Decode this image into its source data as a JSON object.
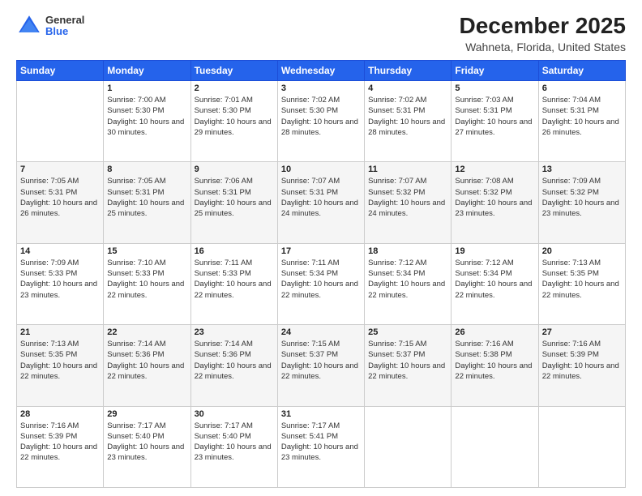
{
  "logo": {
    "general": "General",
    "blue": "Blue"
  },
  "title": "December 2025",
  "location": "Wahneta, Florida, United States",
  "days_of_week": [
    "Sunday",
    "Monday",
    "Tuesday",
    "Wednesday",
    "Thursday",
    "Friday",
    "Saturday"
  ],
  "weeks": [
    [
      {
        "day": "",
        "sunrise": "",
        "sunset": "",
        "daylight": ""
      },
      {
        "day": "1",
        "sunrise": "Sunrise: 7:00 AM",
        "sunset": "Sunset: 5:30 PM",
        "daylight": "Daylight: 10 hours and 30 minutes."
      },
      {
        "day": "2",
        "sunrise": "Sunrise: 7:01 AM",
        "sunset": "Sunset: 5:30 PM",
        "daylight": "Daylight: 10 hours and 29 minutes."
      },
      {
        "day": "3",
        "sunrise": "Sunrise: 7:02 AM",
        "sunset": "Sunset: 5:30 PM",
        "daylight": "Daylight: 10 hours and 28 minutes."
      },
      {
        "day": "4",
        "sunrise": "Sunrise: 7:02 AM",
        "sunset": "Sunset: 5:31 PM",
        "daylight": "Daylight: 10 hours and 28 minutes."
      },
      {
        "day": "5",
        "sunrise": "Sunrise: 7:03 AM",
        "sunset": "Sunset: 5:31 PM",
        "daylight": "Daylight: 10 hours and 27 minutes."
      },
      {
        "day": "6",
        "sunrise": "Sunrise: 7:04 AM",
        "sunset": "Sunset: 5:31 PM",
        "daylight": "Daylight: 10 hours and 26 minutes."
      }
    ],
    [
      {
        "day": "7",
        "sunrise": "Sunrise: 7:05 AM",
        "sunset": "Sunset: 5:31 PM",
        "daylight": "Daylight: 10 hours and 26 minutes."
      },
      {
        "day": "8",
        "sunrise": "Sunrise: 7:05 AM",
        "sunset": "Sunset: 5:31 PM",
        "daylight": "Daylight: 10 hours and 25 minutes."
      },
      {
        "day": "9",
        "sunrise": "Sunrise: 7:06 AM",
        "sunset": "Sunset: 5:31 PM",
        "daylight": "Daylight: 10 hours and 25 minutes."
      },
      {
        "day": "10",
        "sunrise": "Sunrise: 7:07 AM",
        "sunset": "Sunset: 5:31 PM",
        "daylight": "Daylight: 10 hours and 24 minutes."
      },
      {
        "day": "11",
        "sunrise": "Sunrise: 7:07 AM",
        "sunset": "Sunset: 5:32 PM",
        "daylight": "Daylight: 10 hours and 24 minutes."
      },
      {
        "day": "12",
        "sunrise": "Sunrise: 7:08 AM",
        "sunset": "Sunset: 5:32 PM",
        "daylight": "Daylight: 10 hours and 23 minutes."
      },
      {
        "day": "13",
        "sunrise": "Sunrise: 7:09 AM",
        "sunset": "Sunset: 5:32 PM",
        "daylight": "Daylight: 10 hours and 23 minutes."
      }
    ],
    [
      {
        "day": "14",
        "sunrise": "Sunrise: 7:09 AM",
        "sunset": "Sunset: 5:33 PM",
        "daylight": "Daylight: 10 hours and 23 minutes."
      },
      {
        "day": "15",
        "sunrise": "Sunrise: 7:10 AM",
        "sunset": "Sunset: 5:33 PM",
        "daylight": "Daylight: 10 hours and 22 minutes."
      },
      {
        "day": "16",
        "sunrise": "Sunrise: 7:11 AM",
        "sunset": "Sunset: 5:33 PM",
        "daylight": "Daylight: 10 hours and 22 minutes."
      },
      {
        "day": "17",
        "sunrise": "Sunrise: 7:11 AM",
        "sunset": "Sunset: 5:34 PM",
        "daylight": "Daylight: 10 hours and 22 minutes."
      },
      {
        "day": "18",
        "sunrise": "Sunrise: 7:12 AM",
        "sunset": "Sunset: 5:34 PM",
        "daylight": "Daylight: 10 hours and 22 minutes."
      },
      {
        "day": "19",
        "sunrise": "Sunrise: 7:12 AM",
        "sunset": "Sunset: 5:34 PM",
        "daylight": "Daylight: 10 hours and 22 minutes."
      },
      {
        "day": "20",
        "sunrise": "Sunrise: 7:13 AM",
        "sunset": "Sunset: 5:35 PM",
        "daylight": "Daylight: 10 hours and 22 minutes."
      }
    ],
    [
      {
        "day": "21",
        "sunrise": "Sunrise: 7:13 AM",
        "sunset": "Sunset: 5:35 PM",
        "daylight": "Daylight: 10 hours and 22 minutes."
      },
      {
        "day": "22",
        "sunrise": "Sunrise: 7:14 AM",
        "sunset": "Sunset: 5:36 PM",
        "daylight": "Daylight: 10 hours and 22 minutes."
      },
      {
        "day": "23",
        "sunrise": "Sunrise: 7:14 AM",
        "sunset": "Sunset: 5:36 PM",
        "daylight": "Daylight: 10 hours and 22 minutes."
      },
      {
        "day": "24",
        "sunrise": "Sunrise: 7:15 AM",
        "sunset": "Sunset: 5:37 PM",
        "daylight": "Daylight: 10 hours and 22 minutes."
      },
      {
        "day": "25",
        "sunrise": "Sunrise: 7:15 AM",
        "sunset": "Sunset: 5:37 PM",
        "daylight": "Daylight: 10 hours and 22 minutes."
      },
      {
        "day": "26",
        "sunrise": "Sunrise: 7:16 AM",
        "sunset": "Sunset: 5:38 PM",
        "daylight": "Daylight: 10 hours and 22 minutes."
      },
      {
        "day": "27",
        "sunrise": "Sunrise: 7:16 AM",
        "sunset": "Sunset: 5:39 PM",
        "daylight": "Daylight: 10 hours and 22 minutes."
      }
    ],
    [
      {
        "day": "28",
        "sunrise": "Sunrise: 7:16 AM",
        "sunset": "Sunset: 5:39 PM",
        "daylight": "Daylight: 10 hours and 22 minutes."
      },
      {
        "day": "29",
        "sunrise": "Sunrise: 7:17 AM",
        "sunset": "Sunset: 5:40 PM",
        "daylight": "Daylight: 10 hours and 23 minutes."
      },
      {
        "day": "30",
        "sunrise": "Sunrise: 7:17 AM",
        "sunset": "Sunset: 5:40 PM",
        "daylight": "Daylight: 10 hours and 23 minutes."
      },
      {
        "day": "31",
        "sunrise": "Sunrise: 7:17 AM",
        "sunset": "Sunset: 5:41 PM",
        "daylight": "Daylight: 10 hours and 23 minutes."
      },
      {
        "day": "",
        "sunrise": "",
        "sunset": "",
        "daylight": ""
      },
      {
        "day": "",
        "sunrise": "",
        "sunset": "",
        "daylight": ""
      },
      {
        "day": "",
        "sunrise": "",
        "sunset": "",
        "daylight": ""
      }
    ]
  ]
}
